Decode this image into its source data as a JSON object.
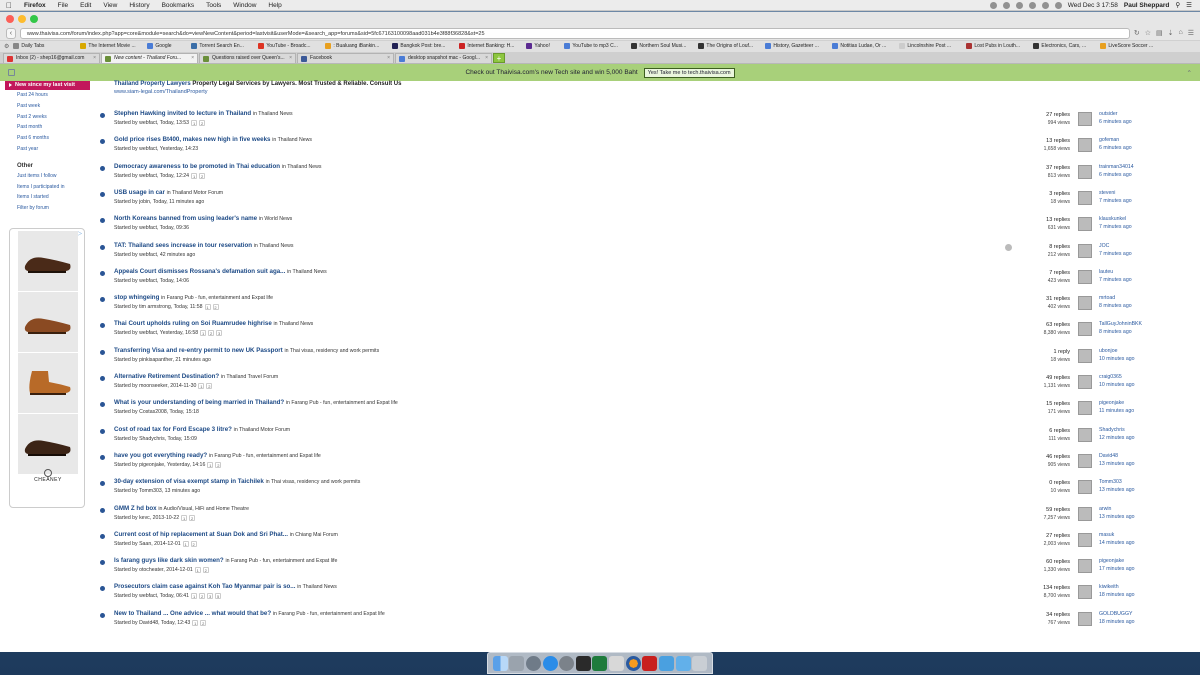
{
  "menubar": {
    "app": "Firefox",
    "items": [
      "File",
      "Edit",
      "View",
      "History",
      "Bookmarks",
      "Tools",
      "Window",
      "Help"
    ],
    "clock": "Wed Dec 3  17:58",
    "user": "Paul Sheppard"
  },
  "browser": {
    "url": "www.thaivisa.com/forum/index.php?app=core&module=search&do=viewNewContent&period=lastvisit&userMode=&search_app=forums&sid=5fc67163100098aad031b4e3f88f36828&st=25",
    "bookmarks": [
      {
        "label": "Daily Tabs",
        "color": "#888"
      },
      {
        "label": "The Internet Movie ...",
        "color": "#d8a800"
      },
      {
        "label": "Google",
        "color": "#4a7cd6"
      },
      {
        "label": "Torrent Search En...",
        "color": "#3a6ea8"
      },
      {
        "label": "YouTube - Broadc...",
        "color": "#d32"
      },
      {
        "label": ": Bualuang iBankin...",
        "color": "#e8a020"
      },
      {
        "label": "Bangkok Post: bre...",
        "color": "#225"
      },
      {
        "label": "Internet Banking: H...",
        "color": "#c22"
      },
      {
        "label": "Yahoo!",
        "color": "#5b2a91"
      },
      {
        "label": "YouTube to mp3 C...",
        "color": "#4a7cd6"
      },
      {
        "label": "Northern Soul Musi...",
        "color": "#333"
      },
      {
        "label": "The Origins of Louf...",
        "color": "#333"
      },
      {
        "label": "History, Gazetteer ...",
        "color": "#4a7cd6"
      },
      {
        "label": "Notitias Ludae, Or ...",
        "color": "#4a7cd6"
      },
      {
        "label": "Lincolnshire Post ...",
        "color": "#ccc"
      },
      {
        "label": "Lost Pubs in Louth...",
        "color": "#a33"
      },
      {
        "label": "Electronics, Cars, ...",
        "color": "#333"
      },
      {
        "label": "LiveScore Soccer ...",
        "color": "#e8a020"
      }
    ],
    "tabs": [
      {
        "label": "Inbox (2) - shep16@gmail.com",
        "color": "#d33"
      },
      {
        "label": "New content - Thailand Foru...",
        "color": "#6a8f3a",
        "active": true
      },
      {
        "label": "Questions raised over Queen's...",
        "color": "#6a8f3a"
      },
      {
        "label": "Facebook",
        "color": "#3b5998"
      },
      {
        "label": "desktop snapshot mac - Googl...",
        "color": "#4a7cd6"
      }
    ]
  },
  "banner": {
    "text": "Check out Thaivisa.com's new Tech site and win 5,000 Baht",
    "button": "Yes! Take me to tech.thaivisa.com"
  },
  "sidebar": {
    "active": "New since my last visit",
    "periods": [
      "Past 24 hours",
      "Past week",
      "Past 2 weeks",
      "Past month",
      "Past 6 months",
      "Past year"
    ],
    "other_heading": "Other",
    "other": [
      "Just items I follow",
      "Items I participated in",
      "Items I started",
      "Filter by forum"
    ]
  },
  "ad": {
    "badge": "▷",
    "brand": "CHEANEY"
  },
  "promo": {
    "title": "Thailand Property Lawyers",
    "desc": "Property Legal Services by Lawyers. Most Trusted & Reliable. Consult Us",
    "url": "www.siam-legal.com/ThailandProperty"
  },
  "topics": [
    {
      "title": "Stephen Hawking invited to lecture in Thailand",
      "forum": "in Thailand News",
      "meta": "Started by webfact, Today, 13:53",
      "pages": [
        "1",
        "2"
      ],
      "replies": "27 replies",
      "views": "994 views",
      "user": "outsider",
      "time": "6 minutes ago"
    },
    {
      "title": "Gold price rises Bt400, makes new high in five weeks",
      "forum": "in Thailand News",
      "meta": "Started by webfact, Yesterday, 14:23",
      "pages": [],
      "replies": "13 replies",
      "views": "1,658 views",
      "user": "gofeman",
      "time": "6 minutes ago"
    },
    {
      "title": "Democracy awareness to be promoted in Thai education",
      "forum": "in Thailand News",
      "meta": "Started by webfact, Today, 12:24",
      "pages": [
        "1",
        "2"
      ],
      "replies": "37 replies",
      "views": "813 views",
      "user": "trainman34014",
      "time": "6 minutes ago"
    },
    {
      "title": "USB usage in car",
      "forum": "in Thailand Motor Forum",
      "meta": "Started by jobin, Today, 11 minutes ago",
      "pages": [],
      "replies": "3 replies",
      "views": "18 views",
      "user": "steveni",
      "time": "7 minutes ago"
    },
    {
      "title": "North Koreans banned from using leader's name",
      "forum": "in World News",
      "meta": "Started by webfact, Today, 09:36",
      "pages": [],
      "replies": "13 replies",
      "views": "631 views",
      "user": "klauskunkel",
      "time": "7 minutes ago"
    },
    {
      "title": "TAT: Thailand sees increase in tour reservation",
      "forum": "in Thailand News",
      "meta": "Started by webfact, 42 minutes ago",
      "pages": [],
      "replies": "8 replies",
      "views": "212 views",
      "user": "JOC",
      "time": "7 minutes ago"
    },
    {
      "title": "Appeals Court dismisses Rossana's defamation suit aga...",
      "forum": "in Thailand News",
      "meta": "Started by webfact, Today, 14:06",
      "pages": [],
      "replies": "7 replies",
      "views": "423 views",
      "user": "lauteu",
      "time": "7 minutes ago"
    },
    {
      "title": "stop whingeing",
      "forum": "in Farang Pub - fun, entertainment and Expat life",
      "meta": "Started by tim armstrong, Today, 11:58",
      "pages": [
        "1",
        "2"
      ],
      "replies": "31 replies",
      "views": "402 views",
      "user": "mrtoad",
      "time": "8 minutes ago"
    },
    {
      "title": "Thai Court upholds ruling on Soi Ruamrudee highrise",
      "forum": "in Thailand News",
      "meta": "Started by webfact, Yesterday, 16:58",
      "pages": [
        "1",
        "2",
        "3"
      ],
      "replies": "63 replies",
      "views": "8,380 views",
      "user": "TallGuyJohninBKK",
      "time": "8 minutes ago"
    },
    {
      "title": "Transferring Visa and re-entry permit to new UK Passport",
      "forum": "in Thai visas, residency and work permits",
      "meta": "Started by pinkisapanther, 21 minutes ago",
      "pages": [],
      "replies": "1 reply",
      "views": "18 views",
      "user": "ubonjoe",
      "time": "10 minutes ago"
    },
    {
      "title": "Alternative Retirement Destination?",
      "forum": "in Thailand Travel Forum",
      "meta": "Started by moonseeker, 2014-11-30",
      "pages": [
        "1",
        "2"
      ],
      "replies": "49 replies",
      "views": "1,131 views",
      "user": "craig0365",
      "time": "10 minutes ago"
    },
    {
      "title": "What is your understanding of being married in Thailand?",
      "forum": "in Farang Pub - fun, entertainment and Expat life",
      "meta": "Started by Costas2008, Today, 15:18",
      "pages": [],
      "replies": "15 replies",
      "views": "171 views",
      "user": "pigeonjake",
      "time": "11 minutes ago"
    },
    {
      "title": "Cost of road tax for Ford Escape 3 litre?",
      "forum": "in Thailand Motor Forum",
      "meta": "Started by Shadychris, Today, 15:09",
      "pages": [],
      "replies": "6 replies",
      "views": "111 views",
      "user": "Shadychris",
      "time": "12 minutes ago"
    },
    {
      "title": "have you got everything ready?",
      "forum": "in Farang Pub - fun, entertainment and Expat life",
      "meta": "Started by pigeonjake, Yesterday, 14:16",
      "pages": [
        "1",
        "2"
      ],
      "replies": "46 replies",
      "views": "905 views",
      "user": "David48",
      "time": "13 minutes ago"
    },
    {
      "title": "30-day extension of visa exempt stamp in Taichilek",
      "forum": "in Thai visas, residency and work permits",
      "meta": "Started by Tomm303, 13 minutes ago",
      "pages": [],
      "replies": "0 replies",
      "views": "10 views",
      "user": "Tomm303",
      "time": "13 minutes ago"
    },
    {
      "title": "GMM Z hd box",
      "forum": "in Audio/Visual, HiFi and Home Theatre",
      "meta": "Started by kevc, 2013-10-22",
      "pages": [
        "1",
        "2"
      ],
      "replies": "59 replies",
      "views": "7,257 views",
      "user": "arwin",
      "time": "13 minutes ago"
    },
    {
      "title": "Current cost of hip replacement at Suan Dok and Sri Phat...",
      "forum": "in Chiang Mai Forum",
      "meta": "Started by Saan, 2014-12-01",
      "pages": [
        "1",
        "2"
      ],
      "replies": "27 replies",
      "views": "2,003 views",
      "user": "masuk",
      "time": "14 minutes ago"
    },
    {
      "title": "Is farang guys like dark skin women?",
      "forum": "in Farang Pub - fun, entertainment and Expat life",
      "meta": "Started by otocheater, 2014-12-01",
      "pages": [
        "1",
        "2"
      ],
      "replies": "60 replies",
      "views": "1,330 views",
      "user": "pigeonjake",
      "time": "17 minutes ago"
    },
    {
      "title": "Prosecutors claim case against Koh Tao Myanmar pair is so...",
      "forum": "in Thailand News",
      "meta": "Started by webfact, Today, 06:41",
      "pages": [
        "1",
        "2",
        "3",
        "5"
      ],
      "replies": "134 replies",
      "views": "8,700 views",
      "user": "kiwikeith",
      "time": "18 minutes ago"
    },
    {
      "title": "New to Thailand ... One advice ... what would that be?",
      "forum": "in Farang Pub - fun, entertainment and Expat life",
      "meta": "Started by David48, Today, 12:43",
      "pages": [
        "1",
        "2"
      ],
      "replies": "34 replies",
      "views": "767 views",
      "user": "GOLDBUGGY",
      "time": "18 minutes ago"
    }
  ]
}
